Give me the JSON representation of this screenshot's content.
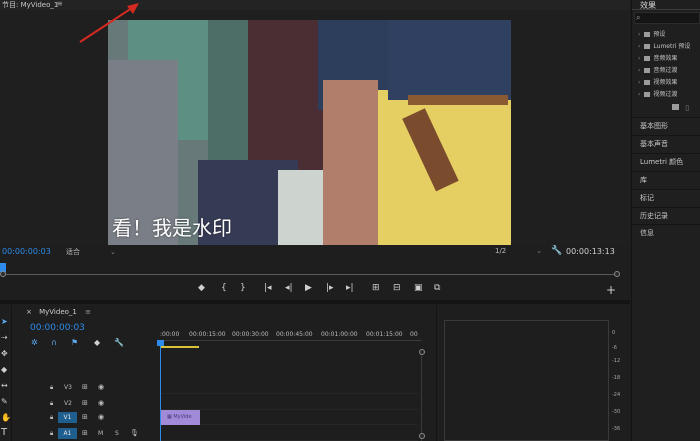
{
  "program_monitor": {
    "title": "节目: MyVideo_1",
    "menu_icon": "≡",
    "watermark_text": "看！我是水印",
    "timecode_current": "00:00:00:03",
    "fit_dropdown": "适合",
    "resolution_dropdown": "1/2",
    "timecode_duration": "00:00:13:13",
    "transport": {
      "marker": "marker-icon",
      "in": "{",
      "out": "}",
      "go_in": "go-to-in-icon",
      "step_back": "step-back-icon",
      "play": "play-icon",
      "step_fwd": "step-forward-icon",
      "go_out": "go-to-out-icon",
      "lift": "lift-icon",
      "extract": "extract-icon",
      "export_frame": "camera-icon",
      "compare": "compare-icon",
      "add": "+"
    }
  },
  "timeline": {
    "tab_title": "MyVideo_1",
    "close": "×",
    "menu_icon": "≡",
    "timecode": "00:00:00:03",
    "ruler_labels": [
      ":00:00",
      "00:00:15:00",
      "00:00:30:00",
      "00:00:45:00",
      "00:01:00:00",
      "00:01:15:00",
      "00"
    ],
    "tracks": [
      {
        "name": "V3",
        "target": false
      },
      {
        "name": "V2",
        "target": false
      },
      {
        "name": "V1",
        "target": true
      },
      {
        "name": "A1",
        "target": true,
        "m": "M",
        "s": "S"
      }
    ],
    "clip_label": "MyVide"
  },
  "meter": {
    "labels": [
      "0",
      "-6",
      "-12",
      "-18",
      "-24",
      "-30",
      "-36"
    ]
  },
  "effects_panel": {
    "tab": "效果",
    "items": [
      "预设",
      "Lumetri 预设",
      "音频效果",
      "音频过渡",
      "视频效果",
      "视频过渡"
    ],
    "panels": [
      "基本图形",
      "基本声音",
      "Lumetri 颜色",
      "库",
      "标记",
      "历史记录",
      "信息"
    ]
  },
  "colors": {
    "accent_blue": "#2d8ceb",
    "clip_purple": "#a18bd9",
    "work_area_yellow": "#d9c23a",
    "arrow_red": "#d42a20"
  }
}
